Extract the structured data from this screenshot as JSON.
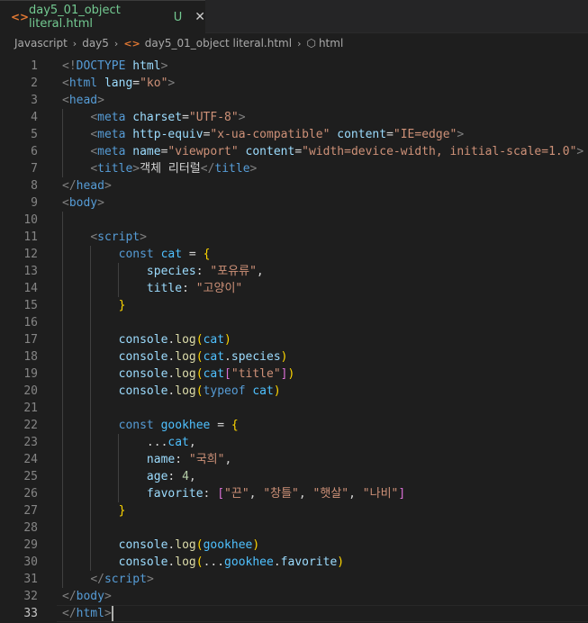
{
  "tab": {
    "icon": "<>",
    "title": "day5_01_object literal.html",
    "status": "U",
    "close": "✕"
  },
  "breadcrumb": {
    "items": [
      "Javascript",
      "day5",
      "day5_01_object literal.html",
      "html"
    ],
    "separator": "›"
  },
  "editor": {
    "current_line": 33,
    "lines": [
      {
        "n": "1",
        "tokens": [
          [
            "tb",
            "<!"
          ],
          [
            "tag",
            "DOCTYPE"
          ],
          [
            "plain",
            " "
          ],
          [
            "attr",
            "html"
          ],
          [
            "tb",
            ">"
          ]
        ]
      },
      {
        "n": "2",
        "tokens": [
          [
            "tb",
            "<"
          ],
          [
            "tag",
            "html"
          ],
          [
            "plain",
            " "
          ],
          [
            "attr",
            "lang"
          ],
          [
            "plain",
            "="
          ],
          [
            "str",
            "\"ko\""
          ],
          [
            "tb",
            ">"
          ]
        ]
      },
      {
        "n": "3",
        "tokens": [
          [
            "tb",
            "<"
          ],
          [
            "tag",
            "head"
          ],
          [
            "tb",
            ">"
          ]
        ]
      },
      {
        "n": "4",
        "tokens": [
          [
            "plain",
            "    "
          ],
          [
            "tb",
            "<"
          ],
          [
            "tag",
            "meta"
          ],
          [
            "plain",
            " "
          ],
          [
            "attr",
            "charset"
          ],
          [
            "plain",
            "="
          ],
          [
            "str",
            "\"UTF-8\""
          ],
          [
            "tb",
            ">"
          ]
        ]
      },
      {
        "n": "5",
        "tokens": [
          [
            "plain",
            "    "
          ],
          [
            "tb",
            "<"
          ],
          [
            "tag",
            "meta"
          ],
          [
            "plain",
            " "
          ],
          [
            "attr",
            "http-equiv"
          ],
          [
            "plain",
            "="
          ],
          [
            "str",
            "\"x-ua-compatible\""
          ],
          [
            "plain",
            " "
          ],
          [
            "attr",
            "content"
          ],
          [
            "plain",
            "="
          ],
          [
            "str",
            "\"IE=edge\""
          ],
          [
            "tb",
            ">"
          ]
        ]
      },
      {
        "n": "6",
        "tokens": [
          [
            "plain",
            "    "
          ],
          [
            "tb",
            "<"
          ],
          [
            "tag",
            "meta"
          ],
          [
            "plain",
            " "
          ],
          [
            "attr",
            "name"
          ],
          [
            "plain",
            "="
          ],
          [
            "str",
            "\"viewport\""
          ],
          [
            "plain",
            " "
          ],
          [
            "attr",
            "content"
          ],
          [
            "plain",
            "="
          ],
          [
            "str",
            "\"width=device-width, initial-scale=1.0\""
          ],
          [
            "tb",
            ">"
          ]
        ]
      },
      {
        "n": "7",
        "tokens": [
          [
            "plain",
            "    "
          ],
          [
            "tb",
            "<"
          ],
          [
            "tag",
            "title"
          ],
          [
            "tb",
            ">"
          ],
          [
            "plain",
            "객체 리터럴"
          ],
          [
            "tb",
            "</"
          ],
          [
            "tag",
            "title"
          ],
          [
            "tb",
            ">"
          ]
        ]
      },
      {
        "n": "8",
        "tokens": [
          [
            "tb",
            "</"
          ],
          [
            "tag",
            "head"
          ],
          [
            "tb",
            ">"
          ]
        ]
      },
      {
        "n": "9",
        "tokens": [
          [
            "tb",
            "<"
          ],
          [
            "tag",
            "body"
          ],
          [
            "tb",
            ">"
          ]
        ]
      },
      {
        "n": "10",
        "tokens": []
      },
      {
        "n": "11",
        "tokens": [
          [
            "plain",
            "    "
          ],
          [
            "tb",
            "<"
          ],
          [
            "tag",
            "script"
          ],
          [
            "tb",
            ">"
          ]
        ]
      },
      {
        "n": "12",
        "tokens": [
          [
            "plain",
            "        "
          ],
          [
            "kw",
            "const"
          ],
          [
            "plain",
            " "
          ],
          [
            "var",
            "cat"
          ],
          [
            "plain",
            " = "
          ],
          [
            "b1",
            "{"
          ]
        ]
      },
      {
        "n": "13",
        "tokens": [
          [
            "plain",
            "            "
          ],
          [
            "prop",
            "species"
          ],
          [
            "plain",
            ": "
          ],
          [
            "str",
            "\"포유류\""
          ],
          [
            "plain",
            ","
          ]
        ]
      },
      {
        "n": "14",
        "tokens": [
          [
            "plain",
            "            "
          ],
          [
            "prop",
            "title"
          ],
          [
            "plain",
            ": "
          ],
          [
            "str",
            "\"고양이\""
          ]
        ]
      },
      {
        "n": "15",
        "tokens": [
          [
            "plain",
            "        "
          ],
          [
            "b1",
            "}"
          ]
        ]
      },
      {
        "n": "16",
        "tokens": []
      },
      {
        "n": "17",
        "tokens": [
          [
            "plain",
            "        "
          ],
          [
            "prop",
            "console"
          ],
          [
            "plain",
            "."
          ],
          [
            "fn",
            "log"
          ],
          [
            "b1",
            "("
          ],
          [
            "var",
            "cat"
          ],
          [
            "b1",
            ")"
          ]
        ]
      },
      {
        "n": "18",
        "tokens": [
          [
            "plain",
            "        "
          ],
          [
            "prop",
            "console"
          ],
          [
            "plain",
            "."
          ],
          [
            "fn",
            "log"
          ],
          [
            "b1",
            "("
          ],
          [
            "var",
            "cat"
          ],
          [
            "plain",
            "."
          ],
          [
            "prop",
            "species"
          ],
          [
            "b1",
            ")"
          ]
        ]
      },
      {
        "n": "19",
        "tokens": [
          [
            "plain",
            "        "
          ],
          [
            "prop",
            "console"
          ],
          [
            "plain",
            "."
          ],
          [
            "fn",
            "log"
          ],
          [
            "b1",
            "("
          ],
          [
            "var",
            "cat"
          ],
          [
            "b2",
            "["
          ],
          [
            "str",
            "\"title\""
          ],
          [
            "b2",
            "]"
          ],
          [
            "b1",
            ")"
          ]
        ]
      },
      {
        "n": "20",
        "tokens": [
          [
            "plain",
            "        "
          ],
          [
            "prop",
            "console"
          ],
          [
            "plain",
            "."
          ],
          [
            "fn",
            "log"
          ],
          [
            "b1",
            "("
          ],
          [
            "kw",
            "typeof"
          ],
          [
            "plain",
            " "
          ],
          [
            "var",
            "cat"
          ],
          [
            "b1",
            ")"
          ]
        ]
      },
      {
        "n": "21",
        "tokens": []
      },
      {
        "n": "22",
        "tokens": [
          [
            "plain",
            "        "
          ],
          [
            "kw",
            "const"
          ],
          [
            "plain",
            " "
          ],
          [
            "var",
            "gookhee"
          ],
          [
            "plain",
            " = "
          ],
          [
            "b1",
            "{"
          ]
        ]
      },
      {
        "n": "23",
        "tokens": [
          [
            "plain",
            "            "
          ],
          [
            "plain",
            "..."
          ],
          [
            "var",
            "cat"
          ],
          [
            "plain",
            ","
          ]
        ]
      },
      {
        "n": "24",
        "tokens": [
          [
            "plain",
            "            "
          ],
          [
            "prop",
            "name"
          ],
          [
            "plain",
            ": "
          ],
          [
            "str",
            "\"국희\""
          ],
          [
            "plain",
            ","
          ]
        ]
      },
      {
        "n": "25",
        "tokens": [
          [
            "plain",
            "            "
          ],
          [
            "prop",
            "age"
          ],
          [
            "plain",
            ": "
          ],
          [
            "num",
            "4"
          ],
          [
            "plain",
            ","
          ]
        ]
      },
      {
        "n": "26",
        "tokens": [
          [
            "plain",
            "            "
          ],
          [
            "prop",
            "favorite"
          ],
          [
            "plain",
            ": "
          ],
          [
            "b2",
            "["
          ],
          [
            "str",
            "\"끈\""
          ],
          [
            "plain",
            ", "
          ],
          [
            "str",
            "\"창틀\""
          ],
          [
            "plain",
            ", "
          ],
          [
            "str",
            "\"햇살\""
          ],
          [
            "plain",
            ", "
          ],
          [
            "str",
            "\"나비\""
          ],
          [
            "b2",
            "]"
          ]
        ]
      },
      {
        "n": "27",
        "tokens": [
          [
            "plain",
            "        "
          ],
          [
            "b1",
            "}"
          ]
        ]
      },
      {
        "n": "28",
        "tokens": []
      },
      {
        "n": "29",
        "tokens": [
          [
            "plain",
            "        "
          ],
          [
            "prop",
            "console"
          ],
          [
            "plain",
            "."
          ],
          [
            "fn",
            "log"
          ],
          [
            "b1",
            "("
          ],
          [
            "var",
            "gookhee"
          ],
          [
            "b1",
            ")"
          ]
        ]
      },
      {
        "n": "30",
        "tokens": [
          [
            "plain",
            "        "
          ],
          [
            "prop",
            "console"
          ],
          [
            "plain",
            "."
          ],
          [
            "fn",
            "log"
          ],
          [
            "b1",
            "("
          ],
          [
            "plain",
            "..."
          ],
          [
            "var",
            "gookhee"
          ],
          [
            "plain",
            "."
          ],
          [
            "prop",
            "favorite"
          ],
          [
            "b1",
            ")"
          ]
        ]
      },
      {
        "n": "31",
        "tokens": [
          [
            "plain",
            "    "
          ],
          [
            "tb",
            "</"
          ],
          [
            "tag",
            "script"
          ],
          [
            "tb",
            ">"
          ]
        ]
      },
      {
        "n": "32",
        "tokens": [
          [
            "tb",
            "</"
          ],
          [
            "tag",
            "body"
          ],
          [
            "tb",
            ">"
          ]
        ]
      },
      {
        "n": "33",
        "tokens": [
          [
            "tb",
            "</"
          ],
          [
            "tag",
            "html"
          ],
          [
            "tb",
            ">"
          ]
        ]
      }
    ]
  }
}
